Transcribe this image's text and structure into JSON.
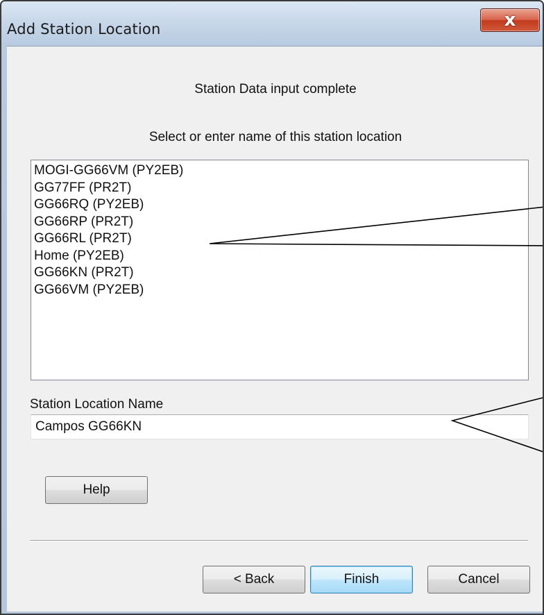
{
  "window": {
    "title": "Add Station Location",
    "close_label": "x"
  },
  "header": {
    "status": "Station Data input complete",
    "instruction": "Select or enter name of this station location"
  },
  "locations": [
    "MOGI-GG66VM (PY2EB)",
    "GG77FF (PR2T)",
    "GG66RQ (PY2EB)",
    "GG66RP (PR2T)",
    "GG66RL (PR2T)",
    "Home (PY2EB)",
    "GG66KN (PR2T)",
    "GG66VM (PY2EB)"
  ],
  "name_field": {
    "label": "Station Location Name",
    "value": "Campos GG66KN"
  },
  "buttons": {
    "help": "Help",
    "back": "< Back",
    "finish": "Finish",
    "cancel": "Cancel"
  }
}
